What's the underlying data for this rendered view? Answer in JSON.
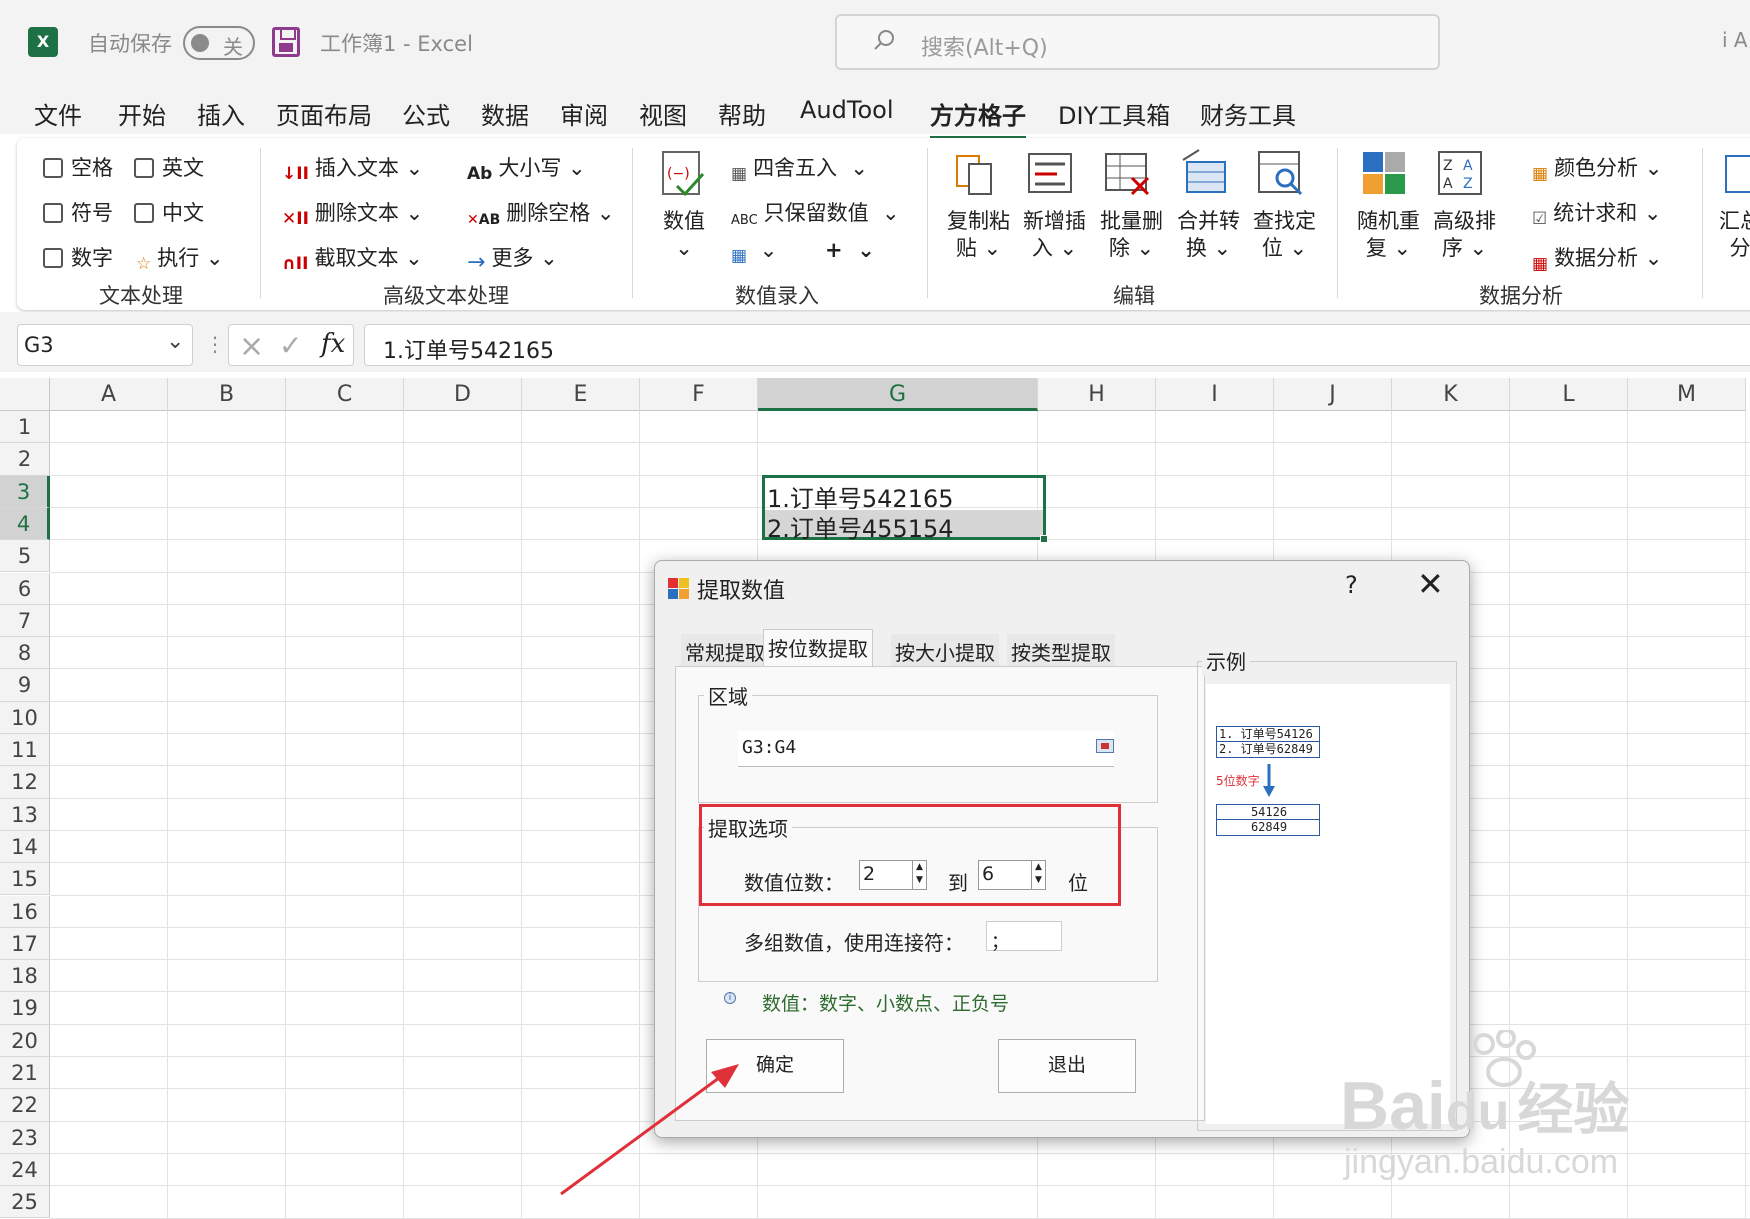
{
  "titlebar": {
    "app_logo": "X",
    "autosave_label": "自动保存",
    "autosave_state": "关",
    "doc_title": "工作簿1  -  Excel",
    "search_placeholder": "搜索(Alt+Q)",
    "user_fragment": "i A"
  },
  "menu": {
    "tabs": [
      "文件",
      "开始",
      "插入",
      "页面布局",
      "公式",
      "数据",
      "审阅",
      "视图",
      "帮助",
      "AudTool",
      "方方格子",
      "DIY工具箱",
      "财务工具"
    ],
    "active": "方方格子"
  },
  "ribbon": {
    "text_processing": {
      "label": "文本处理",
      "checks": [
        "空格",
        "英文",
        "符号",
        "中文",
        "数字"
      ],
      "execute": "执行"
    },
    "advanced_text": {
      "label": "高级文本处理",
      "insert_text": "插入文本",
      "delete_text": "删除文本",
      "cut_text": "截取文本",
      "case": "大小写",
      "delete_space": "删除空格",
      "more": "更多"
    },
    "value_entry": {
      "label": "数值录入",
      "value": "数值",
      "round": "四舍五入",
      "keep_values": "只保留数值",
      "plus": "+"
    },
    "edit": {
      "label": "编辑",
      "items": [
        {
          "line1": "复制粘",
          "line2": "贴"
        },
        {
          "line1": "新增插",
          "line2": "入"
        },
        {
          "line1": "批量删",
          "line2": "除"
        },
        {
          "line1": "合并转",
          "line2": "换"
        },
        {
          "line1": "查找定",
          "line2": "位"
        }
      ]
    },
    "data_analysis": {
      "label": "数据分析",
      "random_dup": {
        "line1": "随机重",
        "line2": "复"
      },
      "adv_sort": {
        "line1": "高级排",
        "line2": "序"
      },
      "color_analysis": "颜色分析",
      "stat_sum": "统计求和",
      "data_analysis": "数据分析",
      "summary_fragment": {
        "line1": "汇总",
        "line2": "分"
      }
    }
  },
  "formula_bar": {
    "name_box": "G3",
    "fx": "fx",
    "content": "1.订单号542165"
  },
  "grid": {
    "columns": [
      "A",
      "B",
      "C",
      "D",
      "E",
      "F",
      "G",
      "H",
      "I",
      "J",
      "K",
      "L",
      "M"
    ],
    "selected_column": "G",
    "rows": [
      "1",
      "2",
      "3",
      "4",
      "5",
      "6",
      "7",
      "8",
      "9",
      "10",
      "11",
      "12",
      "13",
      "14",
      "15",
      "16",
      "17",
      "18",
      "19",
      "20",
      "21",
      "22",
      "23",
      "24",
      "25"
    ],
    "cells": {
      "G3": "1.订单号542165",
      "G4": "2.订单号455154"
    }
  },
  "dialog": {
    "title": "提取数值",
    "help": "?",
    "close": "✕",
    "tabs": [
      "常规提取",
      "按位数提取",
      "按大小提取",
      "按类型提取"
    ],
    "active_tab": "按位数提取",
    "region_legend": "区域",
    "region_value": "G3:G4",
    "options_legend": "提取选项",
    "digits_label": "数值位数：",
    "digits_from": "2",
    "to_label": "到",
    "digits_to": "6",
    "unit_label": "位",
    "multi_label": "多组数值，使用连接符：",
    "multi_value": "；",
    "info_text": "数值：数字、小数点、正负号",
    "ok": "确定",
    "exit": "退出",
    "example_legend": "示例",
    "example": {
      "input": [
        "1. 订单号54126",
        "2. 订单号62849"
      ],
      "caption": "5位数字",
      "output": [
        "54126",
        "62849"
      ]
    }
  },
  "watermark": {
    "brand": "Bai",
    "brand2": "du",
    "suffix": "经验",
    "url": "jingyan.baidu.com"
  },
  "colors": {
    "excel_green": "#1e7145",
    "highlight_red": "#e0313a",
    "info_green": "#2e6b2e"
  }
}
